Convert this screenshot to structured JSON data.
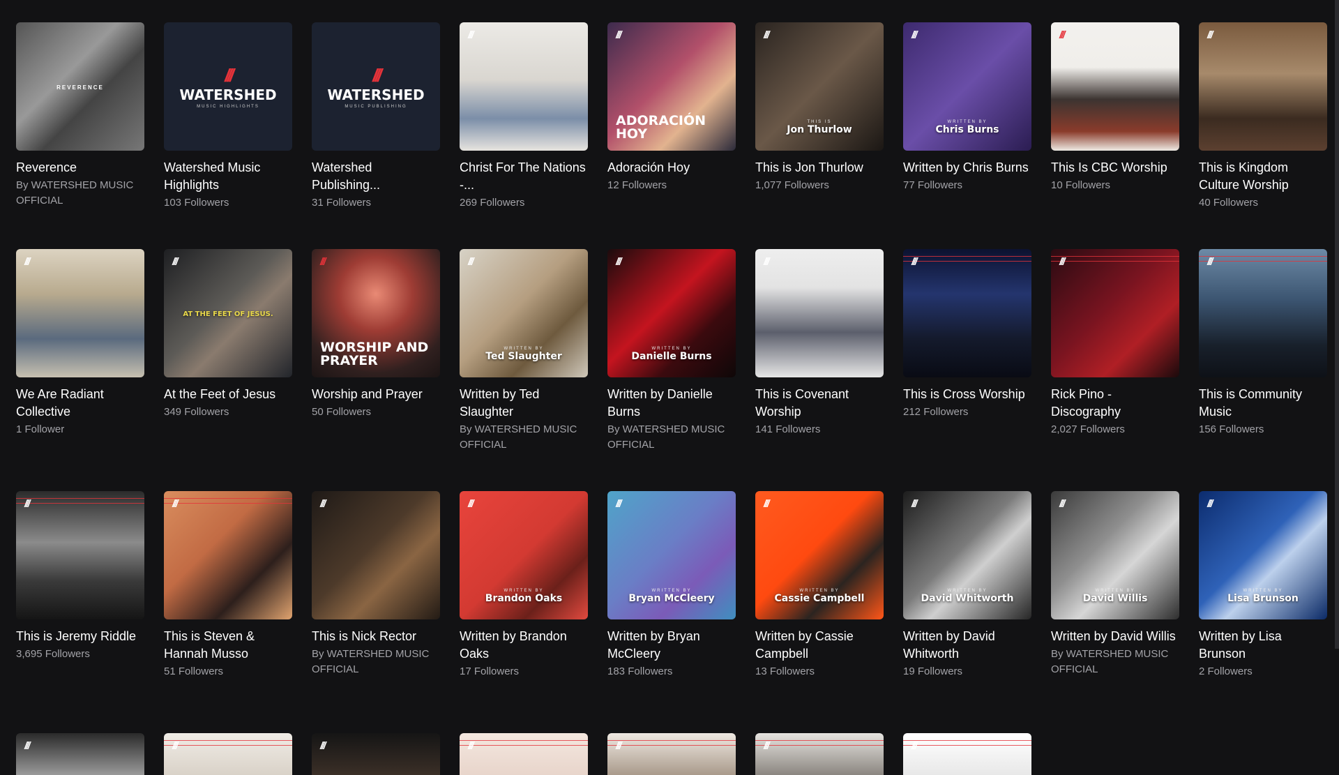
{
  "rows": [
    [
      {
        "title": "Reverence",
        "sub": "By WATERSHED MUSIC OFFICIAL",
        "art": {
          "kind": "reverence",
          "text": "REVERENCE",
          "bg": "linear-gradient(135deg,#555 0%,#999 40%,#444 60%,#777 100%)"
        }
      },
      {
        "title": "Watershed Music Highlights",
        "sub": "103 Followers",
        "art": {
          "kind": "logo",
          "text": "WATERSHED",
          "small": "MUSIC HIGHLIGHTS",
          "bg": "#1c2230"
        }
      },
      {
        "title": "Watershed Publishing...",
        "sub": "31 Followers",
        "art": {
          "kind": "logo",
          "text": "WATERSHED",
          "small": "MUSIC PUBLISHING",
          "bg": "#1c2230"
        }
      },
      {
        "title": "Christ For The Nations -...",
        "sub": "269 Followers",
        "art": {
          "kind": "photo",
          "bg": "linear-gradient(180deg,#eceae6 0%,#d9d6d0 45%,#7b8ea8 75%,#e7e4df 100%)"
        }
      },
      {
        "title": "Adoración Hoy",
        "sub": "12 Followers",
        "art": {
          "kind": "big",
          "text": "ADORACIÓN HOY",
          "bg": "linear-gradient(135deg,#3d2b4d 0%,#b2506a 45%,#e2b38f 70%,#2b2a3a 100%)"
        }
      },
      {
        "title": "This is Jon Thurlow",
        "sub": "1,077 Followers",
        "art": {
          "kind": "this",
          "text": "Jon Thurlow",
          "small": "THIS IS",
          "bg": "linear-gradient(135deg,#2a2420 0%,#6a5848 50%,#1b1714 100%)"
        }
      },
      {
        "title": "Written by Chris Burns",
        "sub": "77 Followers",
        "art": {
          "kind": "written",
          "text": "Chris Burns",
          "small": "WRITTEN BY",
          "bg": "linear-gradient(135deg,#3d2a6e 0%,#6a4ea8 50%,#2b1d52 100%)"
        }
      },
      {
        "title": "This Is CBC Worship",
        "sub": "10 Followers",
        "art": {
          "kind": "photo",
          "mark": "red",
          "bg": "linear-gradient(180deg,#f3f1ee 0%,#f0eeea 35%,#3c3431 60%,#8a3b2b 85%,#eeeae4 100%)"
        }
      },
      {
        "title": "This is Kingdom Culture Worship",
        "sub": "40 Followers",
        "art": {
          "kind": "photo",
          "bg": "linear-gradient(180deg,#7a5a3e 0%,#a78a6b 40%,#3b2b20 75%,#5c4030 100%)"
        }
      }
    ],
    [
      {
        "title": "We Are Radiant Collective",
        "sub": "1 Follower",
        "art": {
          "kind": "photo",
          "bg": "linear-gradient(180deg,#dcd3c1 0%,#b8aa8e 35%,#5a6a7e 70%,#c7c0b0 100%)"
        }
      },
      {
        "title": "At the Feet of Jesus",
        "sub": "349 Followers",
        "art": {
          "kind": "feet",
          "text": "AT THE FEET OF JESUS.",
          "bg": "linear-gradient(135deg,#1e1f22 0%,#5d5b57 45%,#8a7b6e 60%,#22252b 100%)"
        }
      },
      {
        "title": "Worship and Prayer",
        "sub": "50 Followers",
        "art": {
          "kind": "big",
          "text": "WORSHIP AND PRAYER",
          "mark": "red",
          "bg": "radial-gradient(circle at 50% 35%,#e98a75 0%,#9e3c34 35%,#30201f 75%,#1b1414 100%)"
        }
      },
      {
        "title": "Written by Ted Slaughter",
        "sub": "By WATERSHED MUSIC OFFICIAL",
        "art": {
          "kind": "written",
          "text": "Ted Slaughter",
          "small": "WRITTEN BY",
          "bg": "linear-gradient(135deg,#d7d2c6 0%,#b59e80 45%,#6e5a3e 70%,#cfc8ba 100%)"
        }
      },
      {
        "title": "Written by Danielle Burns",
        "sub": "By WATERSHED MUSIC OFFICIAL",
        "art": {
          "kind": "written",
          "text": "Danielle Burns",
          "small": "WRITTEN BY",
          "bg": "linear-gradient(135deg,#1b0b0d 0%,#c4141f 45%,#3b0a0e 70%,#0e0708 100%)"
        }
      },
      {
        "title": "This is Covenant Worship",
        "sub": "141 Followers",
        "art": {
          "kind": "photo",
          "bg": "linear-gradient(180deg,#eeeeee 0%,#e3e3e3 30%,#5c5f6c 65%,#e6e6e6 100%)"
        }
      },
      {
        "title": "This is Cross Worship",
        "sub": "212 Followers",
        "art": {
          "kind": "photo",
          "stripe": true,
          "bg": "linear-gradient(180deg,#0c1230 0%,#24356e 35%,#141a2c 70%,#090b14 100%)"
        }
      },
      {
        "title": "Rick Pino - Discography",
        "sub": "2,027 Followers",
        "art": {
          "kind": "photo",
          "stripe": true,
          "bg": "linear-gradient(135deg,#2a0b12 0%,#7a1420 45%,#b01f25 70%,#1a0a0c 100%)"
        }
      },
      {
        "title": "This is Community Music",
        "sub": "156 Followers",
        "art": {
          "kind": "photo",
          "stripe": true,
          "bg": "linear-gradient(180deg,#6d8aa6 0%,#3b5470 40%,#18202b 75%,#0e1117 100%)"
        }
      }
    ],
    [
      {
        "title": "This is Jeremy Riddle",
        "sub": "3,695 Followers",
        "art": {
          "kind": "photo",
          "stripe": true,
          "bg": "linear-gradient(180deg,#2b2b2b 0%,#8b8b8b 40%,#3a3a3a 70%,#151515 100%)"
        }
      },
      {
        "title": "This is Steven & Hannah Musso",
        "sub": "51 Followers",
        "art": {
          "kind": "photo",
          "stripe": true,
          "bg": "linear-gradient(135deg,#d98d5e 0%,#c26b44 40%,#2d1f1c 70%,#e0a36f 100%)"
        }
      },
      {
        "title": "This is Nick Rector",
        "sub": "By WATERSHED MUSIC OFFICIAL",
        "art": {
          "kind": "photo",
          "bg": "linear-gradient(135deg,#1f1a17 0%,#4d3a2a 45%,#8a6543 65%,#231b15 100%)"
        }
      },
      {
        "title": "Written by Brandon Oaks",
        "sub": "17 Followers",
        "art": {
          "kind": "written",
          "text": "Brandon Oaks",
          "small": "WRITTEN BY",
          "bg": "linear-gradient(135deg,#e8443c 0%,#d33a32 50%,#6b201a 75%,#e24a3f 100%)"
        }
      },
      {
        "title": "Written by Bryan McCleery",
        "sub": "183 Followers",
        "art": {
          "kind": "written",
          "text": "Bryan McCleery",
          "small": "WRITTEN BY",
          "bg": "linear-gradient(135deg,#4fa4c9 0%,#6a7ec6 45%,#7b5bb8 70%,#3f8fbf 100%)"
        }
      },
      {
        "title": "Written by Cassie Campbell",
        "sub": "13 Followers",
        "art": {
          "kind": "written",
          "text": "Cassie Campbell",
          "small": "WRITTEN BY",
          "bg": "linear-gradient(135deg,#ff5a1f 0%,#ff4a10 45%,#2b2420 70%,#ff5618 100%)"
        }
      },
      {
        "title": "Written by David Whitworth",
        "sub": "19 Followers",
        "art": {
          "kind": "written",
          "text": "David Whitworth",
          "small": "WRITTEN BY",
          "bg": "linear-gradient(135deg,#1d1d1d 0%,#7b7b7b 45%,#cfcfcf 60%,#262626 100%)"
        }
      },
      {
        "title": "Written by David Willis",
        "sub": "By WATERSHED MUSIC OFFICIAL",
        "art": {
          "kind": "written",
          "text": "David Willis",
          "small": "WRITTEN BY",
          "bg": "linear-gradient(135deg,#3b3b3b 0%,#8f8f8f 40%,#d6d6d6 60%,#2e2e2e 100%)"
        }
      },
      {
        "title": "Written by Lisa Brunson",
        "sub": "2 Followers",
        "art": {
          "kind": "written",
          "text": "Lisa Brunson",
          "small": "WRITTEN BY",
          "bg": "linear-gradient(135deg,#0c2c6e 0%,#2f62b8 45%,#bcd0ec 60%,#0b2a66 100%)"
        }
      }
    ],
    [
      {
        "art": {
          "kind": "partial",
          "bg": "linear-gradient(180deg,#2a2a2a 0%,#9a9a9a 100%)"
        }
      },
      {
        "art": {
          "kind": "partial",
          "stripe": true,
          "bg": "linear-gradient(180deg,#f0ece6 0%,#d9d2c8 100%)"
        }
      },
      {
        "art": {
          "kind": "partial",
          "bg": "linear-gradient(180deg,#151515 0%,#3b2f27 100%)"
        }
      },
      {
        "art": {
          "kind": "partial",
          "stripe": true,
          "bg": "linear-gradient(180deg,#f4e7df 0%,#e8d5cb 100%)"
        }
      },
      {
        "art": {
          "kind": "partial",
          "stripe": true,
          "bg": "linear-gradient(180deg,#efe9e2 0%,#a99a8b 100%)"
        }
      },
      {
        "art": {
          "kind": "partial",
          "stripe": true,
          "bg": "linear-gradient(180deg,#e6e4e0 0%,#8b8680 100%)"
        }
      },
      {
        "art": {
          "kind": "partial",
          "stripe": true,
          "bg": "linear-gradient(180deg,#ffffff 0%,#e8e8e8 100%)"
        }
      }
    ]
  ]
}
